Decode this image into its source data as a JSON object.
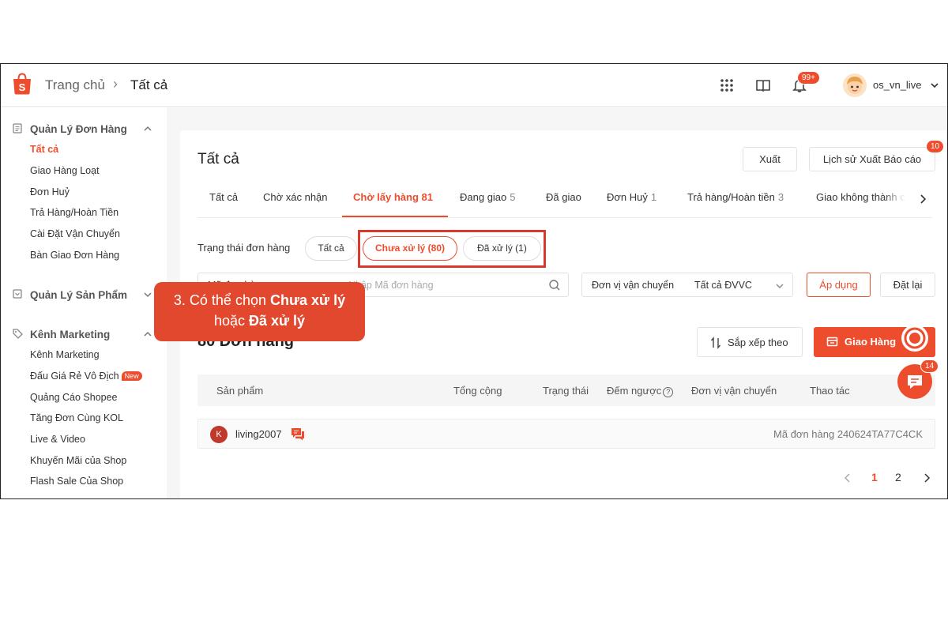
{
  "header": {
    "breadcrumb_home": "Trang chủ",
    "breadcrumb_sep": "›",
    "breadcrumb_current": "Tất cả",
    "notification_badge": "99+",
    "username": "os_vn_live"
  },
  "sidebar": {
    "orders_title": "Quản Lý Đơn Hàng",
    "orders_items": [
      "Tất cả",
      "Giao Hàng Loạt",
      "Đơn Huỷ",
      "Trả Hàng/Hoàn Tiền",
      "Cài Đặt Vận Chuyển",
      "Bàn Giao Đơn Hàng"
    ],
    "products_title": "Quản Lý Sản Phẩm",
    "marketing_title": "Kênh Marketing",
    "marketing_items": [
      "Kênh Marketing",
      "Đấu Giá Rẻ Vô Địch",
      "Quảng Cáo Shopee",
      "Tăng Đơn Cùng KOL",
      "Live & Video",
      "Khuyến Mãi của Shop",
      "Flash Sale Của Shop"
    ],
    "new_tag": "New"
  },
  "main": {
    "title": "Tất cả",
    "export_label": "Xuất",
    "export_history_label": "Lịch sử Xuất Báo cáo",
    "export_badge": "10",
    "tabs": [
      {
        "label": "Tất cả",
        "count": ""
      },
      {
        "label": "Chờ xác nhận",
        "count": ""
      },
      {
        "label": "Chờ lấy hàng 81",
        "count": ""
      },
      {
        "label": "Đang giao",
        "count": "5"
      },
      {
        "label": "Đã giao",
        "count": ""
      },
      {
        "label": "Đơn Huỷ",
        "count": "1"
      },
      {
        "label": "Trả hàng/Hoàn tiền",
        "count": "3"
      },
      {
        "label": "Giao không thành c",
        "count": ""
      }
    ],
    "status_label": "Trạng thái đơn hàng",
    "status_pills": [
      "Tất cả",
      "Chưa xử lý (80)",
      "Đã xử lý (1)"
    ],
    "search_type": "Mã đơn hàng",
    "search_placeholder": "Nhập Mã đơn hàng",
    "shipping_label": "Đơn vị vận chuyển",
    "shipping_value": "Tất cả ĐVVC",
    "apply_label": "Áp dụng",
    "reset_label": "Đặt lại",
    "order_count": "80 Đơn hàng",
    "sort_label": "Sắp xếp theo",
    "ship_label": "Giao Hàng",
    "table_headers": [
      "Sản phẩm",
      "Tổng cộng",
      "Trạng thái",
      "Đếm ngược",
      "Đơn vị vận chuyển",
      "Thao tác"
    ],
    "help_glyph": "?",
    "order_row": {
      "avatar_letter": "K",
      "buyer": "living2007",
      "order_id": "Mã đơn hàng 240624TA77C4CK"
    },
    "pages": [
      "1",
      "2"
    ],
    "chat_badge": "14"
  },
  "callout": {
    "line1_prefix": "3. Có thể chọn ",
    "line1_bold": "Chưa xử lý",
    "line2_prefix": "hoặc ",
    "line2_bold": "Đã xử lý"
  },
  "colors": {
    "brand": "#ee4d2d",
    "callout": "#e2482e"
  },
  "icons": [
    "shopee-logo-icon",
    "apps-grid-icon",
    "book-icon",
    "bell-icon",
    "chevron-down-icon",
    "clipboard-icon",
    "box-icon",
    "tag-icon",
    "search-icon",
    "sort-icon",
    "truck-icon",
    "chat-icon",
    "chevron-left-icon",
    "chevron-right-icon",
    "headset-icon",
    "message-icon"
  ]
}
